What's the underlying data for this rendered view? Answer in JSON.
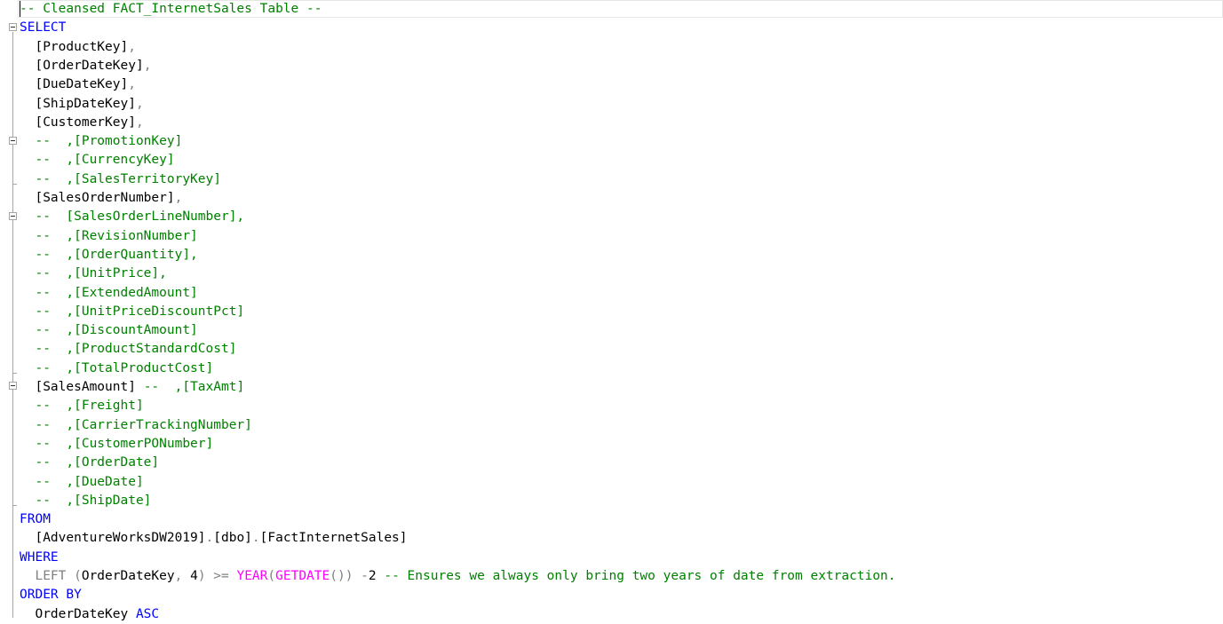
{
  "editor": {
    "colors": {
      "keyword": "#0000ff",
      "comment": "#008000",
      "operator": "#808080",
      "function": "#ff00ff",
      "identifier": "#000000"
    },
    "lines": [
      {
        "tokens": [
          {
            "t": "-- Cleansed FACT_InternetSales Table --",
            "c": "cm"
          }
        ]
      },
      {
        "tokens": [
          {
            "t": "SELECT",
            "c": "kw"
          }
        ]
      },
      {
        "tokens": [
          {
            "t": "  [ProductKey]",
            "c": "tx"
          },
          {
            "t": ",",
            "c": "gy"
          }
        ]
      },
      {
        "tokens": [
          {
            "t": "  [OrderDateKey]",
            "c": "tx"
          },
          {
            "t": ",",
            "c": "gy"
          }
        ]
      },
      {
        "tokens": [
          {
            "t": "  [DueDateKey]",
            "c": "tx"
          },
          {
            "t": ",",
            "c": "gy"
          }
        ]
      },
      {
        "tokens": [
          {
            "t": "  [ShipDateKey]",
            "c": "tx"
          },
          {
            "t": ",",
            "c": "gy"
          }
        ]
      },
      {
        "tokens": [
          {
            "t": "  [CustomerKey]",
            "c": "tx"
          },
          {
            "t": ",",
            "c": "gy"
          }
        ]
      },
      {
        "tokens": [
          {
            "t": "  --  ,[PromotionKey]",
            "c": "cm"
          }
        ]
      },
      {
        "tokens": [
          {
            "t": "  --  ,[CurrencyKey]",
            "c": "cm"
          }
        ]
      },
      {
        "tokens": [
          {
            "t": "  --  ,[SalesTerritoryKey]",
            "c": "cm"
          }
        ]
      },
      {
        "tokens": [
          {
            "t": "  [SalesOrderNumber]",
            "c": "tx"
          },
          {
            "t": ",",
            "c": "gy"
          }
        ]
      },
      {
        "tokens": [
          {
            "t": "  --  [SalesOrderLineNumber],",
            "c": "cm"
          }
        ]
      },
      {
        "tokens": [
          {
            "t": "  --  ,[RevisionNumber]",
            "c": "cm"
          }
        ]
      },
      {
        "tokens": [
          {
            "t": "  --  ,[OrderQuantity],",
            "c": "cm"
          }
        ]
      },
      {
        "tokens": [
          {
            "t": "  --  ,[UnitPrice],",
            "c": "cm"
          }
        ]
      },
      {
        "tokens": [
          {
            "t": "  --  ,[ExtendedAmount]",
            "c": "cm"
          }
        ]
      },
      {
        "tokens": [
          {
            "t": "  --  ,[UnitPriceDiscountPct]",
            "c": "cm"
          }
        ]
      },
      {
        "tokens": [
          {
            "t": "  --  ,[DiscountAmount]",
            "c": "cm"
          }
        ]
      },
      {
        "tokens": [
          {
            "t": "  --  ,[ProductStandardCost]",
            "c": "cm"
          }
        ]
      },
      {
        "tokens": [
          {
            "t": "  --  ,[TotalProductCost]",
            "c": "cm"
          }
        ]
      },
      {
        "tokens": [
          {
            "t": "  [SalesAmount] ",
            "c": "tx"
          },
          {
            "t": "--  ,[TaxAmt]",
            "c": "cm"
          }
        ]
      },
      {
        "tokens": [
          {
            "t": "  --  ,[Freight]",
            "c": "cm"
          }
        ]
      },
      {
        "tokens": [
          {
            "t": "  --  ,[CarrierTrackingNumber]",
            "c": "cm"
          }
        ]
      },
      {
        "tokens": [
          {
            "t": "  --  ,[CustomerPONumber]",
            "c": "cm"
          }
        ]
      },
      {
        "tokens": [
          {
            "t": "  --  ,[OrderDate]",
            "c": "cm"
          }
        ]
      },
      {
        "tokens": [
          {
            "t": "  --  ,[DueDate]",
            "c": "cm"
          }
        ]
      },
      {
        "tokens": [
          {
            "t": "  --  ,[ShipDate]",
            "c": "cm"
          }
        ]
      },
      {
        "tokens": [
          {
            "t": "FROM",
            "c": "kw"
          }
        ]
      },
      {
        "tokens": [
          {
            "t": "  [AdventureWorksDW2019]",
            "c": "tx"
          },
          {
            "t": ".",
            "c": "gy"
          },
          {
            "t": "[dbo]",
            "c": "tx"
          },
          {
            "t": ".",
            "c": "gy"
          },
          {
            "t": "[FactInternetSales]",
            "c": "tx"
          }
        ]
      },
      {
        "tokens": [
          {
            "t": "WHERE",
            "c": "kw"
          }
        ]
      },
      {
        "tokens": [
          {
            "t": "  LEFT ",
            "c": "gy"
          },
          {
            "t": "(",
            "c": "gy"
          },
          {
            "t": "OrderDateKey",
            "c": "tx"
          },
          {
            "t": ", ",
            "c": "gy"
          },
          {
            "t": "4",
            "c": "tx"
          },
          {
            "t": ") >= ",
            "c": "gy"
          },
          {
            "t": "YEAR",
            "c": "fn"
          },
          {
            "t": "(",
            "c": "gy"
          },
          {
            "t": "GETDATE",
            "c": "fn"
          },
          {
            "t": "()) -",
            "c": "gy"
          },
          {
            "t": "2",
            "c": "tx"
          },
          {
            "t": " -- Ensures we always only bring two years of date from extraction.",
            "c": "cm"
          }
        ]
      },
      {
        "tokens": [
          {
            "t": "ORDER BY",
            "c": "kw"
          }
        ]
      },
      {
        "tokens": [
          {
            "t": "  OrderDateKey ",
            "c": "tx"
          },
          {
            "t": "ASC",
            "c": "kw"
          }
        ]
      }
    ]
  }
}
